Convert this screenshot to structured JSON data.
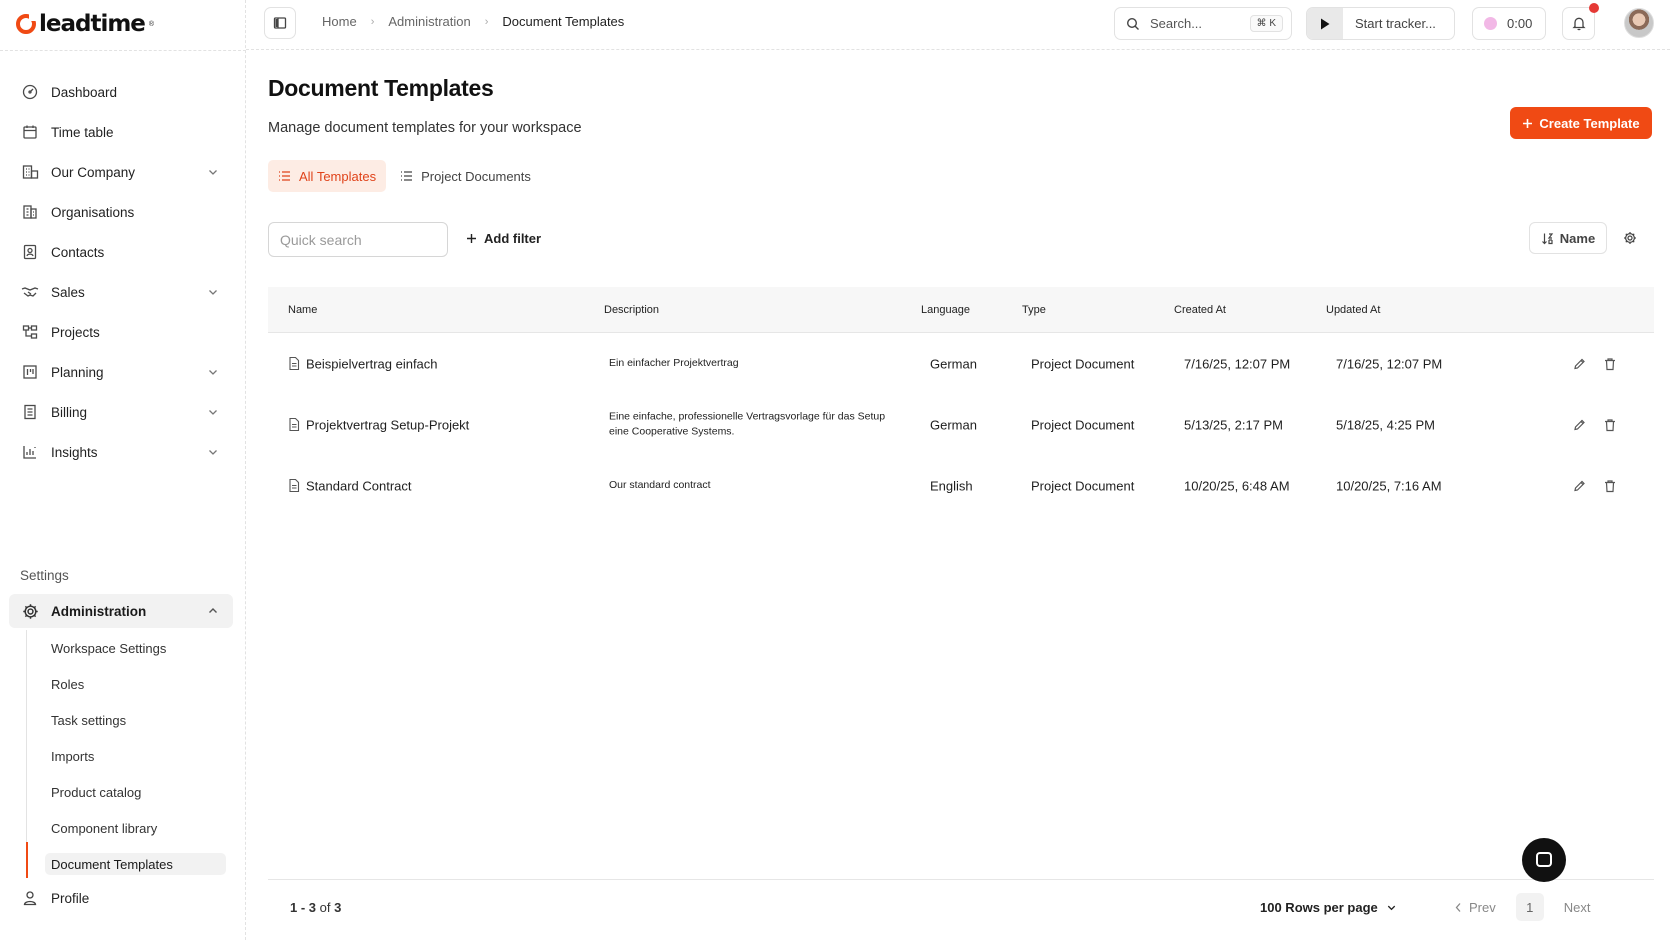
{
  "brand": {
    "name": "leadtime",
    "mark": "®",
    "accent": "#f04a14"
  },
  "sidebar": {
    "items": [
      {
        "label": "Dashboard",
        "icon": "dashboard-gauge-icon",
        "expandable": false
      },
      {
        "label": "Time table",
        "icon": "calendar-icon",
        "expandable": false
      },
      {
        "label": "Our Company",
        "icon": "company-building-icon",
        "expandable": true
      },
      {
        "label": "Organisations",
        "icon": "organisation-building-icon",
        "expandable": false
      },
      {
        "label": "Contacts",
        "icon": "contact-card-icon",
        "expandable": false
      },
      {
        "label": "Sales",
        "icon": "handshake-icon",
        "expandable": true
      },
      {
        "label": "Projects",
        "icon": "project-hierarchy-icon",
        "expandable": false
      },
      {
        "label": "Planning",
        "icon": "planning-board-icon",
        "expandable": true
      },
      {
        "label": "Billing",
        "icon": "billing-receipt-icon",
        "expandable": true
      },
      {
        "label": "Insights",
        "icon": "insights-chart-icon",
        "expandable": true
      }
    ],
    "settings_label": "Settings",
    "administration": {
      "label": "Administration",
      "icon": "gear-icon",
      "subitems": [
        "Workspace Settings",
        "Roles",
        "Task settings",
        "Imports",
        "Product catalog",
        "Component library",
        "Document Templates"
      ],
      "active_subitem": "Document Templates"
    },
    "profile_label": "Profile"
  },
  "topbar": {
    "breadcrumb": [
      "Home",
      "Administration",
      "Document Templates"
    ],
    "search_placeholder": "Search...",
    "search_shortcut": "⌘ K",
    "tracker_label": "Start tracker...",
    "timer_value": "0:00",
    "timer_color": "#f2b8e6",
    "notification_badge_color": "#e53935"
  },
  "page": {
    "title": "Document Templates",
    "subtitle": "Manage document templates for your workspace",
    "create_button": "Create Template",
    "tabs": [
      {
        "label": "All Templates",
        "active": true
      },
      {
        "label": "Project Documents",
        "active": false
      }
    ],
    "quick_search_placeholder": "Quick search",
    "add_filter_label": "Add filter",
    "sort_label": "Name"
  },
  "table": {
    "columns": [
      "Name",
      "Description",
      "Language",
      "Type",
      "Created At",
      "Updated At"
    ],
    "rows": [
      {
        "name": "Beispielvertrag einfach",
        "description": "Ein einfacher Projektvertrag",
        "language": "German",
        "type": "Project Document",
        "created_at": "7/16/25, 12:07 PM",
        "updated_at": "7/16/25, 12:07 PM"
      },
      {
        "name": "Projektvertrag Setup-Projekt",
        "description": "Eine einfache, professionelle Vertragsvorlage für das Setup eine Cooperative Systems.",
        "language": "German",
        "type": "Project Document",
        "created_at": "5/13/25, 2:17 PM",
        "updated_at": "5/18/25, 4:25 PM"
      },
      {
        "name": "Standard Contract",
        "description": "Our standard contract",
        "language": "English",
        "type": "Project Document",
        "created_at": "10/20/25, 6:48 AM",
        "updated_at": "10/20/25, 7:16 AM"
      }
    ]
  },
  "footer": {
    "range": "1 - 3",
    "of_label": "of",
    "total": "3",
    "rows_per_page": "100 Rows per page",
    "prev_label": "Prev",
    "current_page": "1",
    "next_label": "Next"
  }
}
